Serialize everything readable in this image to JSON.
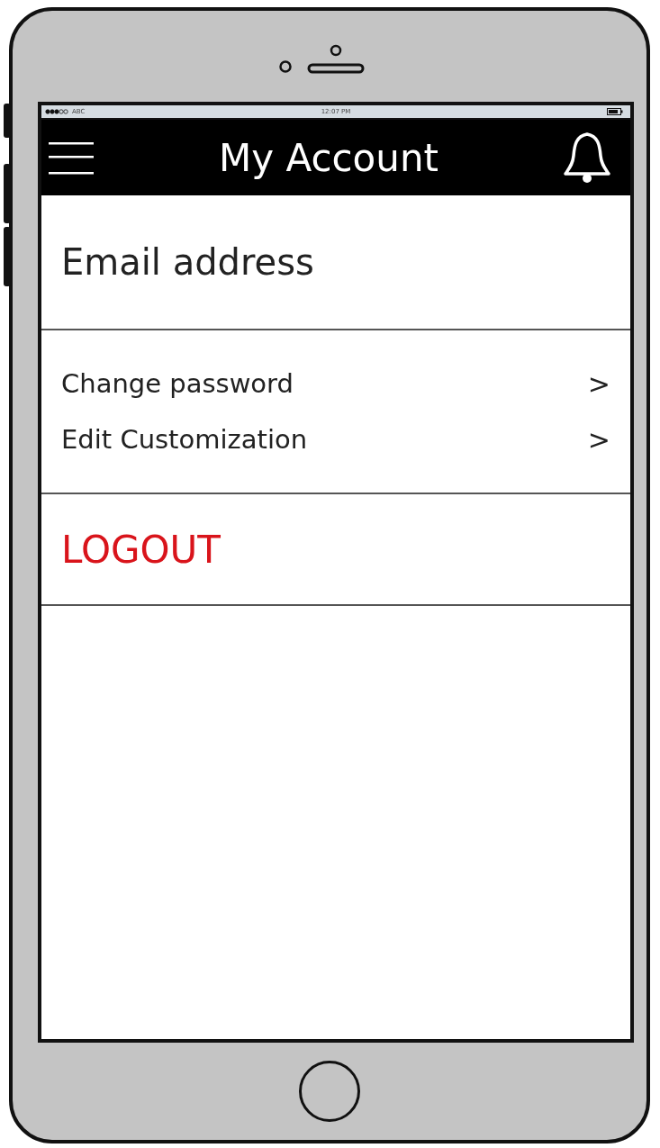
{
  "status_bar": {
    "carrier": "ABC",
    "time": "12:07 PM"
  },
  "nav_bar": {
    "title": "My Account"
  },
  "account": {
    "email_label": "Email address"
  },
  "menu_items": [
    {
      "label": "Change password",
      "chevron": ">"
    },
    {
      "label": "Edit Customization",
      "chevron": ">"
    }
  ],
  "logout": {
    "label": "LOGOUT"
  }
}
